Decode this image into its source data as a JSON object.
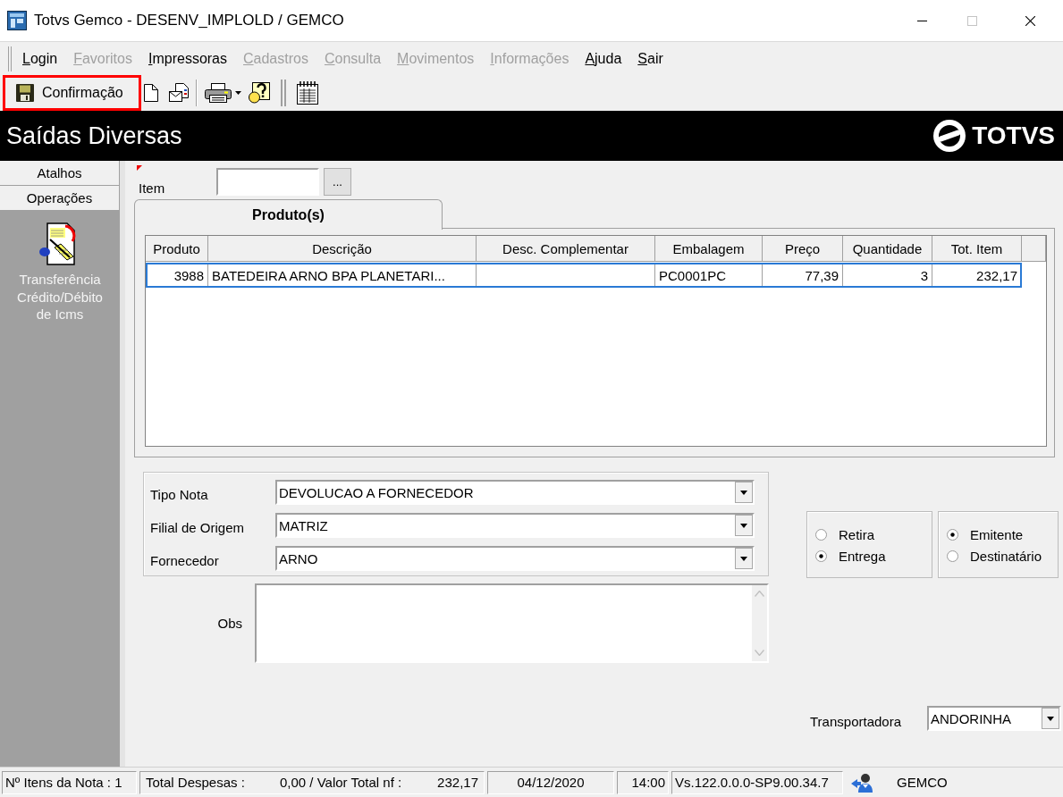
{
  "window": {
    "title": "Totvs Gemco - DESENV_IMPLOLD / GEMCO",
    "maximizable": false
  },
  "menu": [
    {
      "label": "Login",
      "disabled": false
    },
    {
      "label": "Favoritos",
      "disabled": true
    },
    {
      "label": "Impressoras",
      "disabled": false
    },
    {
      "label": "Cadastros",
      "disabled": true
    },
    {
      "label": "Consulta",
      "disabled": true
    },
    {
      "label": "Movimentos",
      "disabled": true
    },
    {
      "label": "Informações",
      "disabled": true
    },
    {
      "label": "Ajuda",
      "disabled": false
    },
    {
      "label": "Sair",
      "disabled": false
    }
  ],
  "toolbar": {
    "confirm_button": {
      "label": "Confirmação",
      "highlighted": true
    }
  },
  "header": {
    "title": "Saídas Diversas",
    "logo": "TOTVS"
  },
  "sidebar": {
    "sections": [
      "Atalhos",
      "Operações"
    ],
    "items": [
      {
        "label": "Transferência Crédito/Débito de Icms"
      }
    ]
  },
  "item_field": {
    "label": "Item",
    "browse_button": "..."
  },
  "tabs": [
    {
      "label": "Produto(s)",
      "selected": true
    }
  ],
  "table": {
    "columns": [
      {
        "label": "Produto",
        "kind": "number"
      },
      {
        "label": "Descrição",
        "kind": "text"
      },
      {
        "label": "Desc. Complementar",
        "kind": "text"
      },
      {
        "label": "Embalagem",
        "kind": "text"
      },
      {
        "label": "Preço",
        "kind": "number"
      },
      {
        "label": "Quantidade",
        "kind": "number"
      },
      {
        "label": "Tot. Item",
        "kind": "number"
      }
    ],
    "rows": [
      {
        "selected": true,
        "cells": [
          "3988",
          "BATEDEIRA ARNO BPA PLANETARI...",
          null,
          "PC0001PC",
          "77,39",
          "3",
          "232,17"
        ]
      }
    ]
  },
  "form": {
    "fields": [
      {
        "label": "Tipo Nota",
        "value": "DEVOLUCAO A FORNECEDOR"
      },
      {
        "label": "Filial de Origem",
        "value": "MATRIZ"
      },
      {
        "label": "Fornecedor",
        "value": "ARNO"
      }
    ],
    "obs": {
      "label": "Obs"
    }
  },
  "radio_groups": [
    {
      "options": [
        {
          "label": "Retira",
          "selected": false
        },
        {
          "label": "Entrega",
          "selected": true
        }
      ]
    },
    {
      "options": [
        {
          "label": "Emitente",
          "selected": true
        },
        {
          "label": "Destinatário",
          "selected": false
        }
      ]
    }
  ],
  "carrier": {
    "label": "Transportadora",
    "value": "ANDORINHA"
  },
  "status_bar": {
    "items_count": "Nº Itens da Nota : 1",
    "expenses_label": "Total Despesas :",
    "expenses_value": "0,00 / Valor Total nf :",
    "total_value": "232,17",
    "date": "04/12/2020",
    "time": "14:00",
    "version": "Vs.122.0.0.0-SP9.00.34.7",
    "user": "GEMCO"
  }
}
